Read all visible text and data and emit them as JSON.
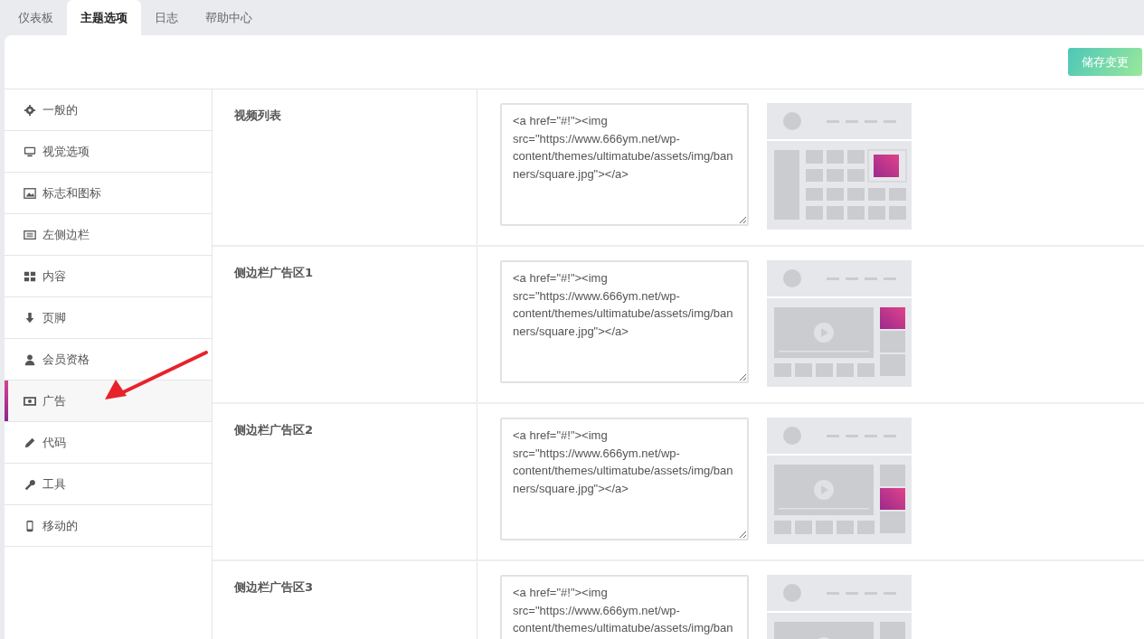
{
  "tabs": [
    {
      "label": "仪表板",
      "selected": false
    },
    {
      "label": "主题选项",
      "selected": true
    },
    {
      "label": "日志",
      "selected": false
    },
    {
      "label": "帮助中心",
      "selected": false
    }
  ],
  "save_button": "储存变更",
  "sidebar": {
    "items": [
      {
        "label": "一般的",
        "kind": "gear",
        "selected": false
      },
      {
        "label": "视觉选项",
        "kind": "monitor",
        "selected": false
      },
      {
        "label": "标志和图标",
        "kind": "image",
        "selected": false
      },
      {
        "label": "左侧边栏",
        "kind": "list",
        "selected": false
      },
      {
        "label": "内容",
        "kind": "grid",
        "selected": false
      },
      {
        "label": "页脚",
        "kind": "down",
        "selected": false
      },
      {
        "label": "会员资格",
        "kind": "user",
        "selected": false
      },
      {
        "label": "广告",
        "kind": "money",
        "selected": true
      },
      {
        "label": "代码",
        "kind": "pencil",
        "selected": false
      },
      {
        "label": "工具",
        "kind": "wrench",
        "selected": false
      },
      {
        "label": "移动的",
        "kind": "phone",
        "selected": false
      }
    ]
  },
  "sections": [
    {
      "label": "视频列表",
      "value": "<a href=\"#!\"><img src=\"https://www.666ym.net/wp-content/themes/ultimatube/assets/img/banners/square.jpg\"></a>",
      "preview": {
        "kind": "grid"
      }
    },
    {
      "label": "侧边栏广告区1",
      "value": "<a href=\"#!\"><img src=\"https://www.666ym.net/wp-content/themes/ultimatube/assets/img/banners/square.jpg\"></a>",
      "preview": {
        "kind": "sidebar-top"
      }
    },
    {
      "label": "侧边栏广告区2",
      "value": "<a href=\"#!\"><img src=\"https://www.666ym.net/wp-content/themes/ultimatube/assets/img/banners/square.jpg\"></a>",
      "preview": {
        "kind": "sidebar-middle"
      }
    },
    {
      "label": "侧边栏广告区3",
      "value": "<a href=\"#!\"><img src=\"https://www.666ym.net/wp-content/themes/ultimatube/assets/img/ban",
      "preview": {
        "kind": "sidebar-plain"
      }
    }
  ]
}
